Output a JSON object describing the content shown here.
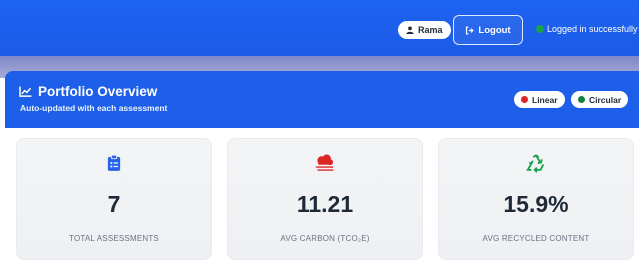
{
  "navbar": {
    "user_name": "Rama",
    "logout_label": "Logout",
    "status_text": "Logged in successfully",
    "status_color": "#16a34a"
  },
  "portfolio": {
    "title": "Portfolio Overview",
    "subtitle": "Auto-updated with each assessment",
    "chips": [
      {
        "label": "Linear",
        "color": "#dc2626"
      },
      {
        "label": "Circular",
        "color": "#15803d"
      }
    ]
  },
  "cards": [
    {
      "value": "7",
      "label": "TOTAL ASSESSMENTS",
      "icon": "clipboard-list-icon",
      "icon_color": "#2563eb"
    },
    {
      "value": "11.21",
      "label": "AVG CARBON (TCO₂E)",
      "icon": "smog-cloud-icon",
      "icon_color": "#dc2626"
    },
    {
      "value": "15.9%",
      "label": "AVG RECYCLED CONTENT",
      "icon": "recycle-icon",
      "icon_color": "#16a34a"
    }
  ],
  "colors": {
    "primary_blue": "#1d5fe8",
    "navbar_blue": "#1e63f1"
  }
}
